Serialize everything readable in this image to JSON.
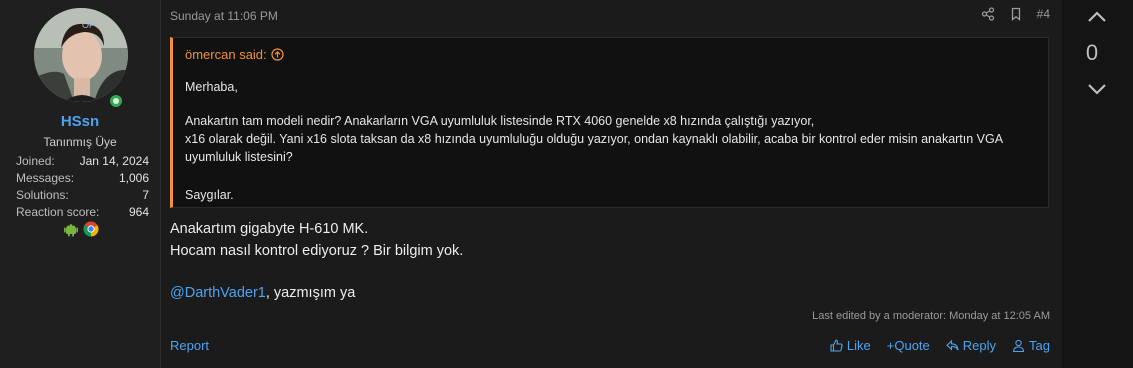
{
  "user": {
    "badge": "OP",
    "name": "HSsn",
    "title": "Tanınmış Üye",
    "stats": [
      {
        "label": "Joined:",
        "value": "Jan 14, 2024"
      },
      {
        "label": "Messages:",
        "value": "1,006"
      },
      {
        "label": "Solutions:",
        "value": "7"
      },
      {
        "label": "Reaction score:",
        "value": "964"
      }
    ],
    "device_icons": [
      "android-icon",
      "chrome-icon"
    ]
  },
  "post": {
    "timestamp": "Sunday at 11:06 PM",
    "number": "#4",
    "quote": {
      "author": "ömercan said:",
      "lines": [
        "Merhaba,",
        "Anakartın tam modeli nedir? Anakarların VGA uyumluluk listesinde RTX 4060 genelde x8 hızında çalıştığı yazıyor,",
        "x16 olarak değil. Yani x16 slota taksan da x8 hızında uyumluluğu olduğu yazıyor, ondan kaynaklı olabilir, acaba bir kontrol eder misin anakartın VGA",
        "uyumluluk listesini?",
        "Saygılar."
      ]
    },
    "body": {
      "line1": "Anakartım gigabyte H-610 MK.",
      "line2": "Hocam nasıl kontrol ediyoruz ? Bir bilgim yok.",
      "mention": "@DarthVader1",
      "mention_suffix": ", yazmışım ya"
    },
    "edited": "Last edited by a moderator: Monday at 12:05 AM",
    "report": "Report",
    "actions": {
      "like": "Like",
      "quote": "+Quote",
      "reply": "Reply",
      "tag": "Tag"
    }
  },
  "votes": {
    "count": "0"
  },
  "colors": {
    "accent": "#4ea3f0",
    "quote_border": "#f0913b",
    "online": "#34a853"
  }
}
